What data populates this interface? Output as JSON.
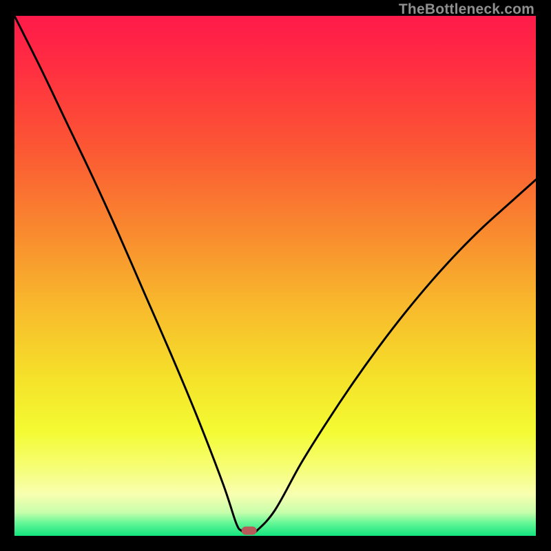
{
  "watermark": "TheBottleneck.com",
  "chart_data": {
    "type": "line",
    "title": "",
    "xlabel": "",
    "ylabel": "",
    "xlim": [
      0,
      100
    ],
    "ylim": [
      0,
      100
    ],
    "grid": false,
    "legend": false,
    "series": [
      {
        "name": "left-curve",
        "x": [
          0,
          5,
          10,
          15,
          20,
          25,
          30,
          35,
          40,
          42.5,
          43.5,
          44
        ],
        "y": [
          100,
          90,
          79.5,
          69,
          58,
          46.5,
          35,
          23,
          10,
          2.5,
          1,
          1
        ]
      },
      {
        "name": "right-curve",
        "x": [
          46,
          46.5,
          50,
          55,
          60,
          65,
          70,
          75,
          80,
          85,
          90,
          95,
          100
        ],
        "y": [
          1,
          1,
          5,
          14,
          22,
          29.5,
          36.5,
          43,
          49,
          54.5,
          59.5,
          64,
          68.5
        ]
      }
    ],
    "marker": {
      "name": "minimum-marker",
      "x": 45,
      "y": 1,
      "color": "#b95a5a"
    },
    "background_gradient": {
      "stops": [
        {
          "offset": 0.0,
          "color": "#ff1a4a"
        },
        {
          "offset": 0.1,
          "color": "#ff2e41"
        },
        {
          "offset": 0.25,
          "color": "#fc5634"
        },
        {
          "offset": 0.4,
          "color": "#f9852f"
        },
        {
          "offset": 0.55,
          "color": "#f8b72c"
        },
        {
          "offset": 0.7,
          "color": "#f5e22a"
        },
        {
          "offset": 0.8,
          "color": "#f4fb33"
        },
        {
          "offset": 0.87,
          "color": "#f6fe77"
        },
        {
          "offset": 0.92,
          "color": "#f8ffb0"
        },
        {
          "offset": 0.955,
          "color": "#c7feac"
        },
        {
          "offset": 0.975,
          "color": "#66f797"
        },
        {
          "offset": 1.0,
          "color": "#13e47f"
        }
      ]
    }
  }
}
